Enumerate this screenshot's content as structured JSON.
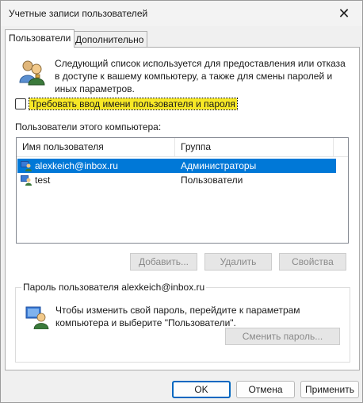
{
  "window": {
    "title": "Учетные записи пользователей",
    "close_glyph": "✕"
  },
  "tabs": [
    {
      "label": "Пользователи",
      "active": true
    },
    {
      "label": "Дополнительно",
      "active": false
    }
  ],
  "intro": {
    "icon": "users-icon",
    "text": "Следующий список используется для предоставления или отказа в доступе к вашему компьютеру, а также для смены паролей и иных параметров."
  },
  "require_login": {
    "label": "Требовать ввод имени пользователя и пароля",
    "checked": false
  },
  "users_section": {
    "label": "Пользователи этого компьютера:",
    "columns": [
      "Имя пользователя",
      "Группа"
    ],
    "rows": [
      {
        "name": "alexkeich@inbox.ru",
        "group": "Администраторы",
        "selected": true
      },
      {
        "name": "test",
        "group": "Пользователи",
        "selected": false
      }
    ]
  },
  "user_buttons": {
    "add": "Добавить...",
    "remove": "Удалить",
    "properties": "Свойства"
  },
  "password_group": {
    "title": "Пароль пользователя alexkeich@inbox.ru",
    "text": "Чтобы изменить свой пароль, перейдите к параметрам компьютера и выберите \"Пользователи\".",
    "change_button": "Сменить пароль..."
  },
  "dialog_buttons": {
    "ok": "OK",
    "cancel": "Отмена",
    "apply": "Применить"
  },
  "colors": {
    "selection": "#0078d7",
    "highlight": "#f7e826"
  }
}
